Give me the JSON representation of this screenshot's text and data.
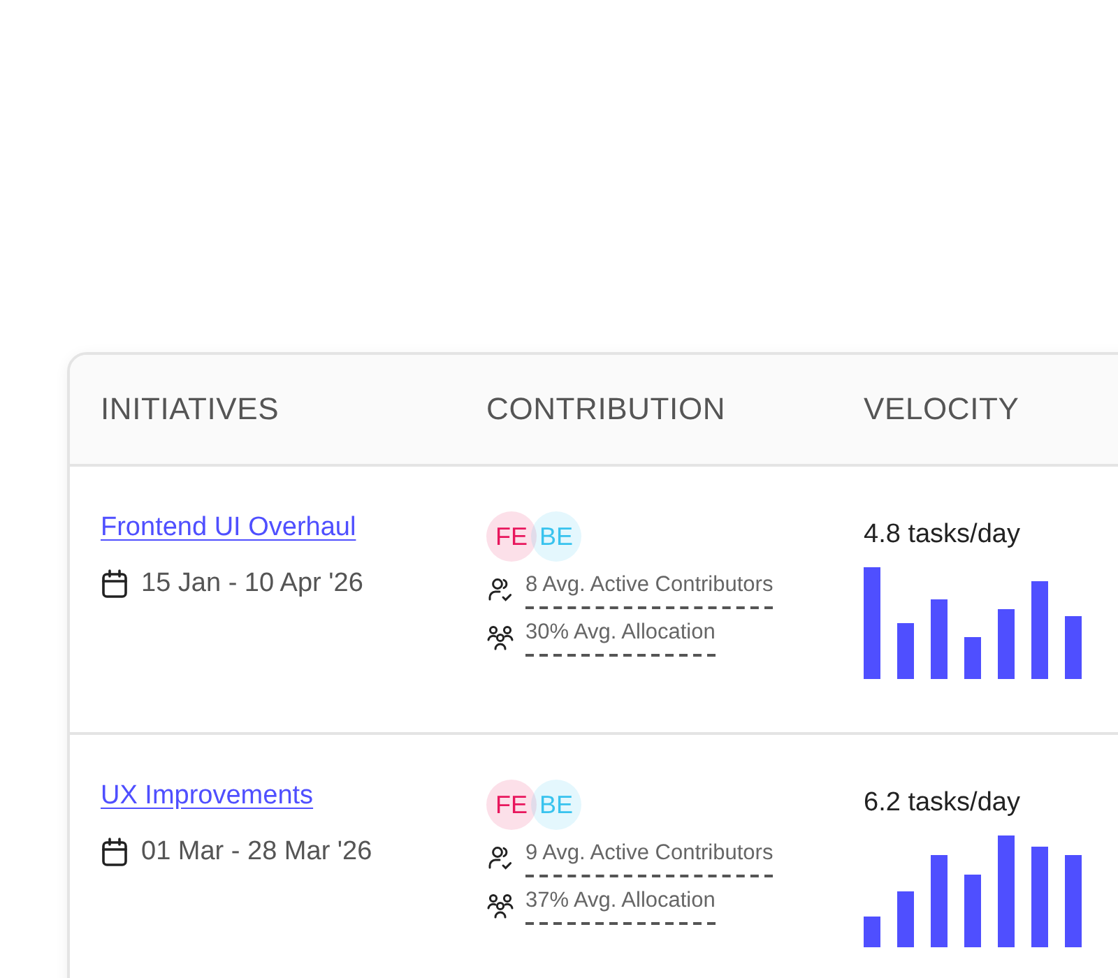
{
  "table": {
    "columns": [
      "INITIATIVES",
      "CONTRIBUTION",
      "VELOCITY"
    ],
    "rows": [
      {
        "name": "Frontend UI Overhaul",
        "dates": "15 Jan - 10 Apr '26",
        "teams": [
          {
            "label": "FE",
            "color": "#e8175d"
          },
          {
            "label": "BE",
            "color": "#38c3ee"
          }
        ],
        "stats": [
          {
            "kind": "contributors",
            "text": "8 Avg. Active Contributors"
          },
          {
            "kind": "allocation",
            "text": "30% Avg. Allocation"
          }
        ],
        "velocity": "4.8 tasks/day"
      },
      {
        "name": "UX Improvements",
        "dates": "01 Mar - 28 Mar '26",
        "teams": [
          {
            "label": "FE",
            "color": "#e8175d"
          },
          {
            "label": "BE",
            "color": "#38c3ee"
          }
        ],
        "stats": [
          {
            "kind": "contributors",
            "text": "9 Avg. Active Contributors"
          },
          {
            "kind": "allocation",
            "text": "37% Avg. Allocation"
          }
        ],
        "velocity": "6.2 tasks/day"
      }
    ]
  }
}
